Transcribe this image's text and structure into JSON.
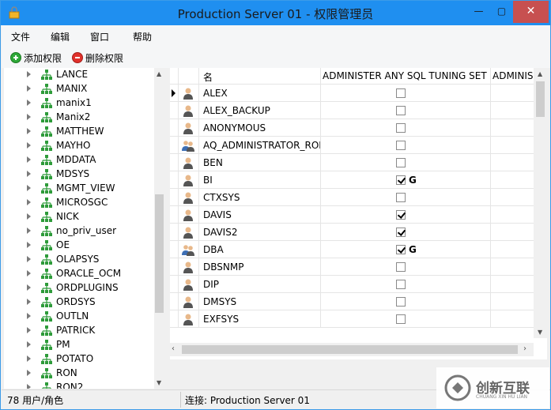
{
  "window": {
    "title": "Production Server 01 - 权限管理员",
    "controls": {
      "minimize": "—",
      "maximize": "▢",
      "close": "✕"
    }
  },
  "menu": {
    "items": [
      {
        "label": "文件"
      },
      {
        "label": "编辑"
      },
      {
        "label": "窗口"
      },
      {
        "label": "帮助"
      }
    ]
  },
  "toolbar": {
    "add_label": "添加权限",
    "remove_label": "删除权限"
  },
  "tree": {
    "items": [
      "LANCE",
      "MANIX",
      "manix1",
      "Manix2",
      "MATTHEW",
      "MAYHO",
      "MDDATA",
      "MDSYS",
      "MGMT_VIEW",
      "MICROSGC",
      "NICK",
      "no_priv_user",
      "OE",
      "OLAPSYS",
      "ORACLE_OCM",
      "ORDPLUGINS",
      "ORDSYS",
      "OUTLN",
      "PATRICK",
      "PM",
      "POTATO",
      "RON",
      "RON2"
    ]
  },
  "grid": {
    "columns": {
      "name": "名",
      "col1": "ADMINISTER ANY SQL TUNING SET",
      "col2": "ADMINIS"
    },
    "rows": [
      {
        "name": "ALEX",
        "type": "user",
        "checked": false,
        "grant": ""
      },
      {
        "name": "ALEX_BACKUP",
        "type": "user",
        "checked": false,
        "grant": ""
      },
      {
        "name": "ANONYMOUS",
        "type": "user",
        "checked": false,
        "grant": ""
      },
      {
        "name": "AQ_ADMINISTRATOR_ROLE",
        "type": "role",
        "checked": false,
        "grant": ""
      },
      {
        "name": "BEN",
        "type": "user",
        "checked": false,
        "grant": ""
      },
      {
        "name": "BI",
        "type": "user",
        "checked": true,
        "grant": "G"
      },
      {
        "name": "CTXSYS",
        "type": "user",
        "checked": false,
        "grant": ""
      },
      {
        "name": "DAVIS",
        "type": "user",
        "checked": true,
        "grant": ""
      },
      {
        "name": "DAVIS2",
        "type": "user",
        "checked": true,
        "grant": ""
      },
      {
        "name": "DBA",
        "type": "role",
        "checked": true,
        "grant": "G"
      },
      {
        "name": "DBSNMP",
        "type": "user",
        "checked": false,
        "grant": ""
      },
      {
        "name": "DIP",
        "type": "user",
        "checked": false,
        "grant": ""
      },
      {
        "name": "DMSYS",
        "type": "user",
        "checked": false,
        "grant": ""
      },
      {
        "name": "EXFSYS",
        "type": "user",
        "checked": false,
        "grant": ""
      }
    ]
  },
  "status": {
    "count": "78 用户/角色",
    "connection": "连接: Production Server 01"
  },
  "watermark": {
    "text": "创新互联",
    "sub": "CHUANG XIN HU LIAN"
  },
  "colors": {
    "titlebar": "#1f8ff0",
    "close": "#c75050",
    "tree_icon": "#2e9b3a",
    "avatar_head": "#e8b88a",
    "avatar_body": "#555555"
  }
}
